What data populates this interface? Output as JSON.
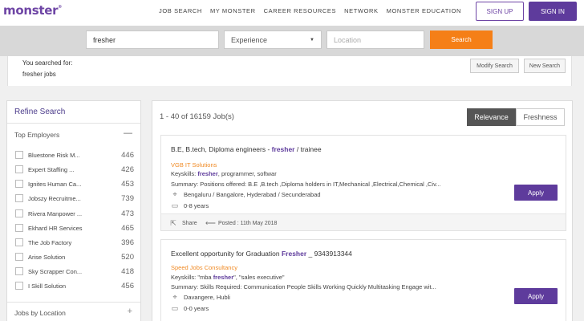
{
  "header": {
    "logo": "monster",
    "logo_mark": "®",
    "nav": [
      "JOB SEARCH",
      "MY MONSTER",
      "CAREER RESOURCES",
      "NETWORK",
      "MONSTER EDUCATION"
    ],
    "signup_label": "SIGN UP",
    "signin_label": "SIGN IN"
  },
  "search": {
    "query": "fresher",
    "experience": "Experience",
    "location_placeholder": "Location",
    "button_label": "Search"
  },
  "searched": {
    "label": "You searched for:",
    "value": "fresher jobs",
    "modify_label": "Modify Search",
    "new_label": "New Search"
  },
  "sidebar": {
    "title": "Refine Search",
    "top_employers_label": "Top Employers",
    "collapse_symbol": "—",
    "employers": [
      {
        "name": "Bluestone Risk M...",
        "count": "446"
      },
      {
        "name": "Expert Staffing ...",
        "count": "426"
      },
      {
        "name": "Ignites Human Ca...",
        "count": "453"
      },
      {
        "name": "Jobszy Recruitme...",
        "count": "739"
      },
      {
        "name": "Rivera Manpower ...",
        "count": "473"
      },
      {
        "name": "Ekhard HR Services",
        "count": "465"
      },
      {
        "name": "The Job Factory",
        "count": "396"
      },
      {
        "name": "Arise Solution",
        "count": "520"
      },
      {
        "name": "Sky Scrapper Con...",
        "count": "418"
      },
      {
        "name": "I Skill Solution",
        "count": "456"
      }
    ],
    "jobs_by_location_label": "Jobs by Location",
    "expand_symbol": "+"
  },
  "results": {
    "count_text": "1 - 40 of 16159 Job(s)",
    "sort_relevance": "Relevance",
    "sort_freshness": "Freshness",
    "jobs": [
      {
        "title_pre": "B.E, B.tech, Diploma engineers - ",
        "title_hl": "fresher",
        "title_post": " / trainee",
        "company": "VGB IT Solutions",
        "keys_pre": "Keyskills: ",
        "keys_hl": "fresher",
        "keys_post": ", programmer, softwar",
        "summary": "Summary: Positions offered: B.E ,B.tech ,Diploma holders in IT,Mechanical ,Electrical,Chemical ,Civ...",
        "location": "Bengaluru / Bangalore, Hyderabad / Secunderabad",
        "experience": "0-8 years",
        "apply_label": "Apply",
        "share_label": "Share",
        "posted": "Posted : 11th May 2018"
      },
      {
        "title_pre": "Excellent opportunity for Graduation ",
        "title_hl": "Fresher",
        "title_post": " _ 9343913344",
        "company": "Speed Jobs Consultancy",
        "keys_pre": "Keyskills: \"mba ",
        "keys_hl": "fresher",
        "keys_post": "\", \"sales executive\"",
        "summary": "Summary: Skills Required: Communication People Skills Working Quickly Multitasking Engage wit...",
        "location": "Davangere, Hubli",
        "experience": "0-0 years",
        "apply_label": "Apply"
      }
    ]
  }
}
